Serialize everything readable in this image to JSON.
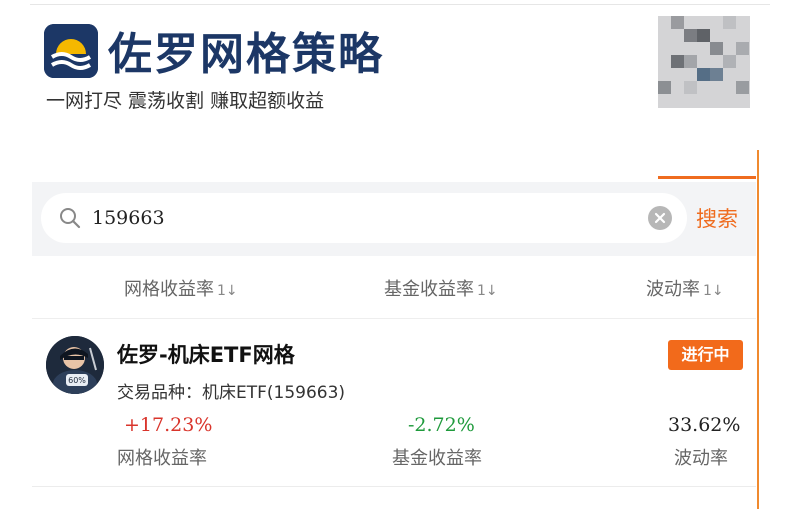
{
  "header": {
    "brand_title": "佐罗网格策略",
    "slogan": "一网打尽 震荡收割 赚取超额收益",
    "logo_icon": "sunrise-wave-logo",
    "brand_color": "#1c3766"
  },
  "search": {
    "query": "159663",
    "search_label": "搜索",
    "search_icon": "search-icon",
    "clear_icon": "clear-icon",
    "accent": "#ef6c1f"
  },
  "sort_bar": {
    "items": [
      {
        "label": "网格收益率",
        "indicator": "1↓"
      },
      {
        "label": "基金收益率",
        "indicator": "1↓"
      },
      {
        "label": "波动率",
        "indicator": "1↓"
      }
    ]
  },
  "card": {
    "title": "佐罗-机床ETF网格",
    "status": "进行中",
    "product_line": "交易品种：机床ETF(159663)",
    "metrics": [
      {
        "value": "+17.23%",
        "label": "网格收益率",
        "color": "#d9342b"
      },
      {
        "value": "-2.72%",
        "label": "基金收益率",
        "color": "#1f9a3c"
      },
      {
        "value": "33.62%",
        "label": "波动率",
        "color": "#222222"
      }
    ]
  }
}
